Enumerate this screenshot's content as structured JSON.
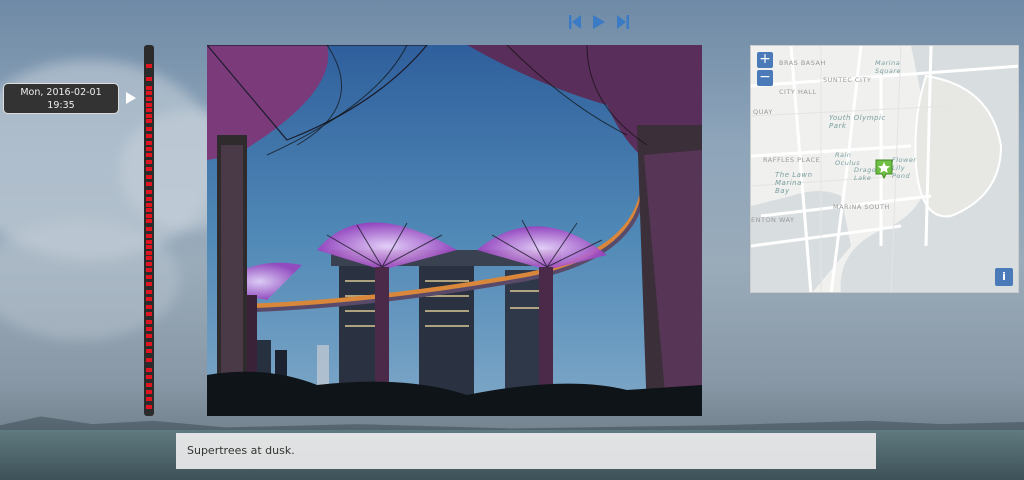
{
  "controls": {
    "prev_icon": "skip-back-icon",
    "play_icon": "play-icon",
    "next_icon": "skip-forward-icon",
    "accent": "#3b7bc6"
  },
  "date": {
    "day": "Mon, 2016-02-01",
    "time": "19:35"
  },
  "timeline": {
    "track_color": "#2b2b2b",
    "marker_color": "#e0141e",
    "markers": [
      0.05,
      0.085,
      0.11,
      0.125,
      0.14,
      0.155,
      0.17,
      0.185,
      0.2,
      0.22,
      0.24,
      0.26,
      0.275,
      0.29,
      0.31,
      0.33,
      0.35,
      0.37,
      0.39,
      0.41,
      0.425,
      0.44,
      0.455,
      0.47,
      0.49,
      0.51,
      0.525,
      0.54,
      0.555,
      0.57,
      0.585,
      0.6,
      0.62,
      0.64,
      0.66,
      0.68,
      0.7,
      0.72,
      0.74,
      0.76,
      0.78,
      0.8,
      0.82,
      0.845,
      0.87,
      0.89,
      0.91,
      0.93,
      0.95,
      0.97
    ]
  },
  "map": {
    "labels": [
      "BRAS BASAH",
      "SUNTEC CITY",
      "Marina Square",
      "CITY HALL",
      "Youth Olympic Park",
      "QUAY",
      "RAFFLES PLACE",
      "Rain Oculus",
      "Dragonfly Lake",
      "Flower Lily Pond",
      "The Lawn Marina Bay",
      "ENTON WAY",
      "MARINA SOUTH"
    ],
    "zoom_in": "+",
    "zoom_out": "−",
    "info": "i",
    "marker_icon": "star-marker-icon"
  },
  "caption": {
    "text": "Supertrees at dusk."
  }
}
